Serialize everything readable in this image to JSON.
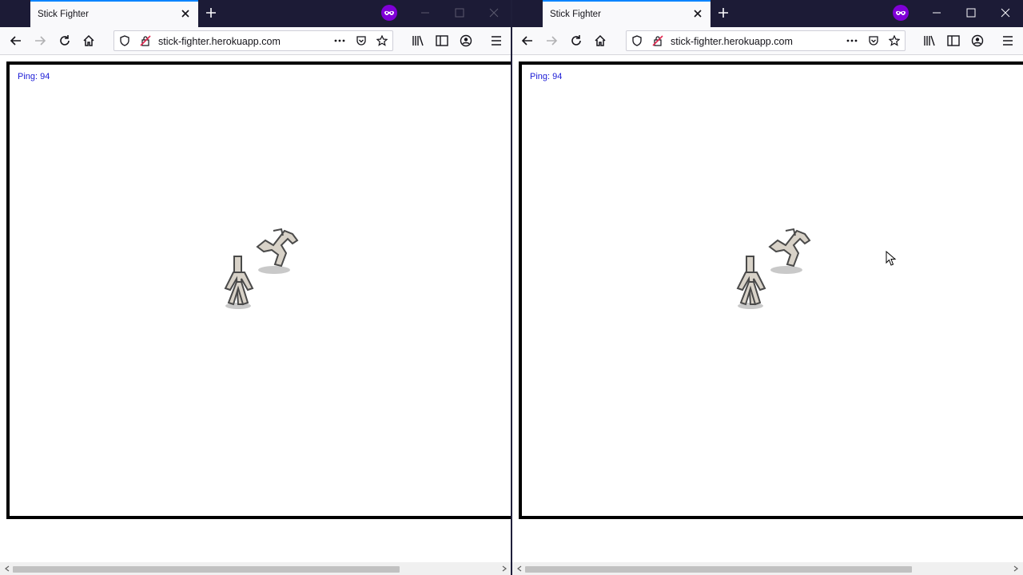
{
  "colors": {
    "titlebar": "#1c1b36",
    "tab_accent": "#0a84ff",
    "private_badge": "#8000d7",
    "ping_text": "#1a1ad6",
    "canvas_border": "#000000"
  },
  "windows": [
    {
      "tab_title": "Stick Fighter",
      "url": "stick-fighter.herokuapp.com",
      "ping_label": "Ping: 94",
      "icons": [
        "close-icon",
        "plus-icon",
        "private-browsing-icon",
        "minimize-icon",
        "maximize-icon",
        "close-icon",
        "back-arrow-icon",
        "forward-arrow-icon",
        "reload-icon",
        "home-icon",
        "shield-icon",
        "insecure-lock-icon",
        "more-icon",
        "pocket-icon",
        "bookmark-star-icon",
        "library-icon",
        "sidebar-icon",
        "account-icon",
        "menu-icon"
      ]
    },
    {
      "tab_title": "Stick Fighter",
      "url": "stick-fighter.herokuapp.com",
      "ping_label": "Ping: 94",
      "icons": [
        "close-icon",
        "plus-icon",
        "private-browsing-icon",
        "minimize-icon",
        "maximize-icon",
        "close-icon",
        "back-arrow-icon",
        "forward-arrow-icon",
        "reload-icon",
        "home-icon",
        "shield-icon",
        "insecure-lock-icon",
        "more-icon",
        "pocket-icon",
        "bookmark-star-icon",
        "library-icon",
        "sidebar-icon",
        "account-icon",
        "menu-icon"
      ]
    }
  ]
}
